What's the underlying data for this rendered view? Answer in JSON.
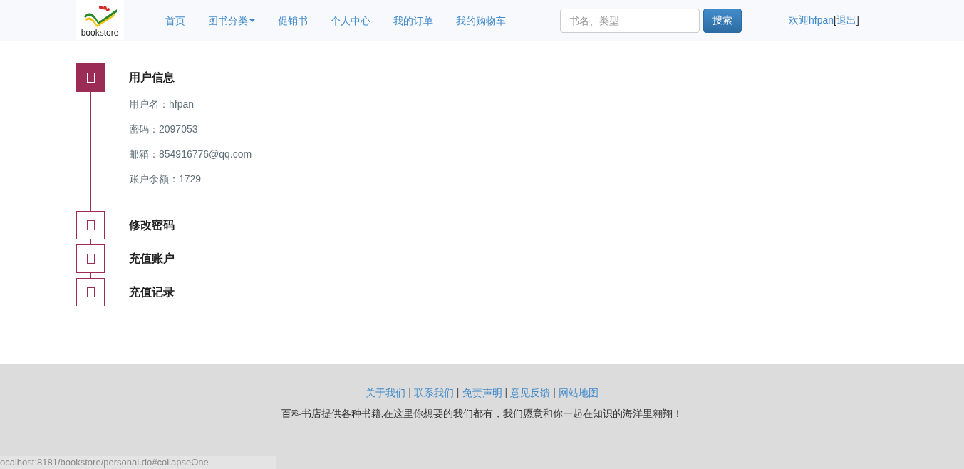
{
  "header": {
    "logo_text": "bookstore",
    "nav": [
      {
        "label": "首页",
        "dropdown": false
      },
      {
        "label": "图书分类",
        "dropdown": true
      },
      {
        "label": "促销书",
        "dropdown": false
      },
      {
        "label": "个人中心",
        "dropdown": false
      },
      {
        "label": "我的订单",
        "dropdown": false
      },
      {
        "label": "我的购物车",
        "dropdown": false
      }
    ],
    "search": {
      "placeholder": "书名、类型",
      "button": "搜索"
    },
    "welcome": "欢迎hfpan",
    "logout_open": "[",
    "logout": "退出",
    "logout_close": "]"
  },
  "sections": [
    {
      "title": "用户信息",
      "expanded": true,
      "details": [
        "用户名：hfpan",
        "密码：2097053",
        "邮箱：854916776@qq.com",
        "账户余额：1729"
      ]
    },
    {
      "title": "修改密码",
      "expanded": false
    },
    {
      "title": "充值账户",
      "expanded": false
    },
    {
      "title": "充值记录",
      "expanded": false
    }
  ],
  "footer": {
    "links": [
      "关于我们",
      "联系我们",
      "免责声明",
      "意见反馈",
      "网站地图"
    ],
    "separator": "|",
    "tagline": "百科书店提供各种书籍,在这里你想要的我们都有，我们愿意和你一起在知识的海洋里翱翔！"
  },
  "status_bar": "ocalhost:8181/bookstore/personal.do#collapseOne"
}
